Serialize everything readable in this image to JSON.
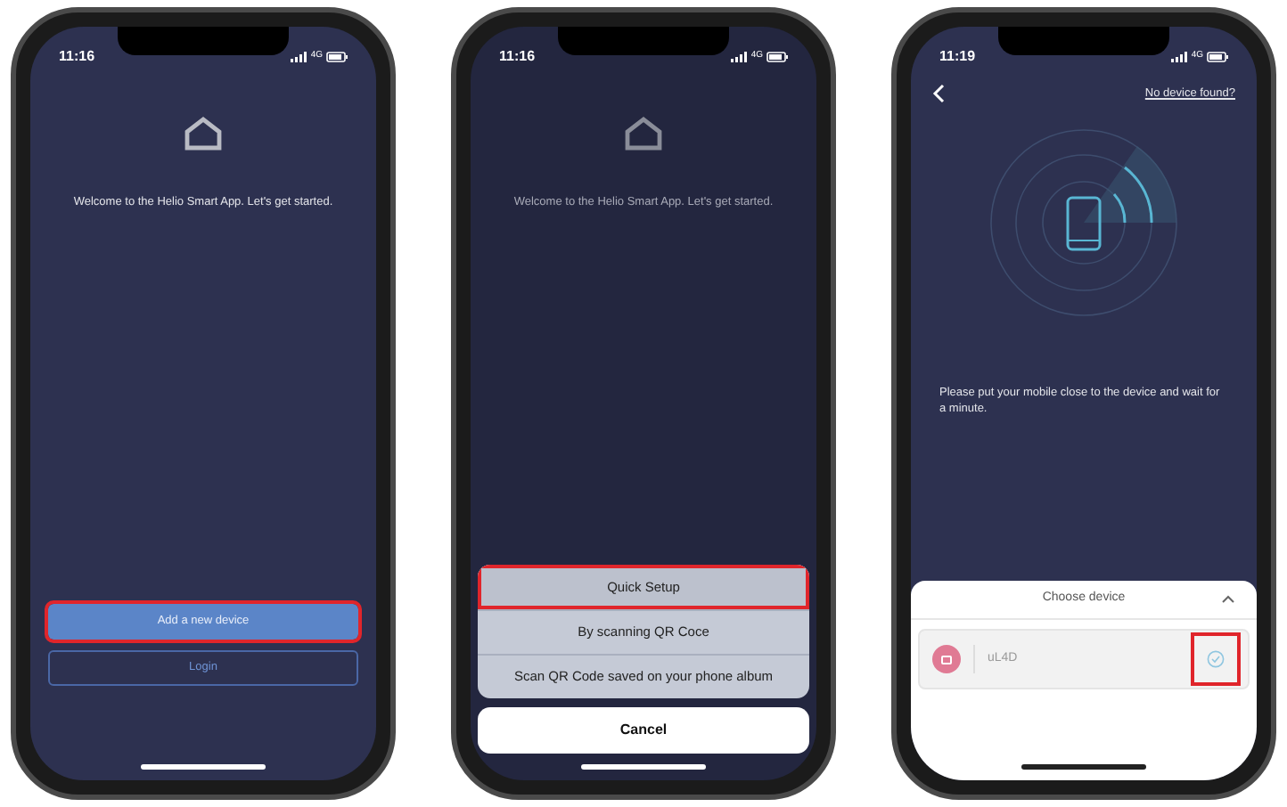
{
  "screens": [
    {
      "kind": "welcome",
      "dimmed": false,
      "status_bar": {
        "time": "11:16",
        "network": "4G"
      },
      "welcome_text": "Welcome to the Helio Smart App. Let's get started.",
      "buttons": [
        {
          "label": "Add a new device",
          "kind": "primary",
          "highlighted": true
        },
        {
          "label": "Login",
          "kind": "outline",
          "highlighted": false
        }
      ]
    },
    {
      "kind": "action_sheet",
      "dimmed": true,
      "status_bar": {
        "time": "11:16",
        "network": "4G"
      },
      "welcome_text": "Welcome to the Helio Smart App. Let's get started.",
      "options": [
        {
          "label": "Quick Setup",
          "highlighted": true
        },
        {
          "label": "By scanning QR Coce",
          "highlighted": false
        },
        {
          "label": "Scan QR Code saved on your phone album",
          "highlighted": false
        }
      ],
      "cancel": "Cancel"
    },
    {
      "kind": "scan",
      "dimmed": false,
      "status_bar": {
        "time": "11:19",
        "network": "4G"
      },
      "link": "No device found?",
      "instruction": "Please put your mobile close to the device and wait for a minute.",
      "sheet": {
        "title": "Choose device",
        "devices": [
          {
            "name": "uL4D",
            "checked": true,
            "highlighted": true
          }
        ]
      }
    }
  ]
}
